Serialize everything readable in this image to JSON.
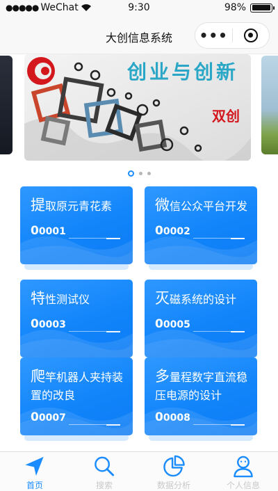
{
  "status_bar": {
    "carrier": "WeChat",
    "time": "9:30",
    "battery": "98%",
    "battery_level": 0.98
  },
  "nav": {
    "title": "大创信息系统",
    "more_icon": "more-dots-icon",
    "close_icon": "target-circle-icon"
  },
  "banner": {
    "slide_title": "创业与创新",
    "slide_brand": "双创",
    "active_index": 0,
    "count": 3
  },
  "cards": [
    {
      "title_first": "提",
      "title_rest": "取原元青花素",
      "count_first": "0",
      "count_rest": "0001"
    },
    {
      "title_first": "微",
      "title_rest": "信公众平台开发",
      "count_first": "0",
      "count_rest": "0002"
    },
    {
      "title_first": "特",
      "title_rest": "性测试仪",
      "count_first": "0",
      "count_rest": "0003"
    },
    {
      "title_first": "灭",
      "title_rest": "磁系统的设计",
      "count_first": "0",
      "count_rest": "0005"
    },
    {
      "title_first": "爬",
      "title_rest": "竿机器人夹持装置的改良",
      "count_first": "0",
      "count_rest": "0007"
    },
    {
      "title_first": "多",
      "title_rest": "量程数字直流稳压电源的设计",
      "count_first": "0",
      "count_rest": "0008"
    }
  ],
  "tabs": [
    {
      "label": "首页",
      "icon": "navigation-arrow-icon",
      "active": true
    },
    {
      "label": "搜索",
      "icon": "search-icon",
      "active": false
    },
    {
      "label": "数据分析",
      "icon": "pie-chart-icon",
      "active": false
    },
    {
      "label": "个人信息",
      "icon": "user-icon",
      "active": false
    }
  ],
  "colors": {
    "accent": "#1a8cff",
    "card": "#1285fb",
    "inactive_tab": "#c9c9c9"
  }
}
